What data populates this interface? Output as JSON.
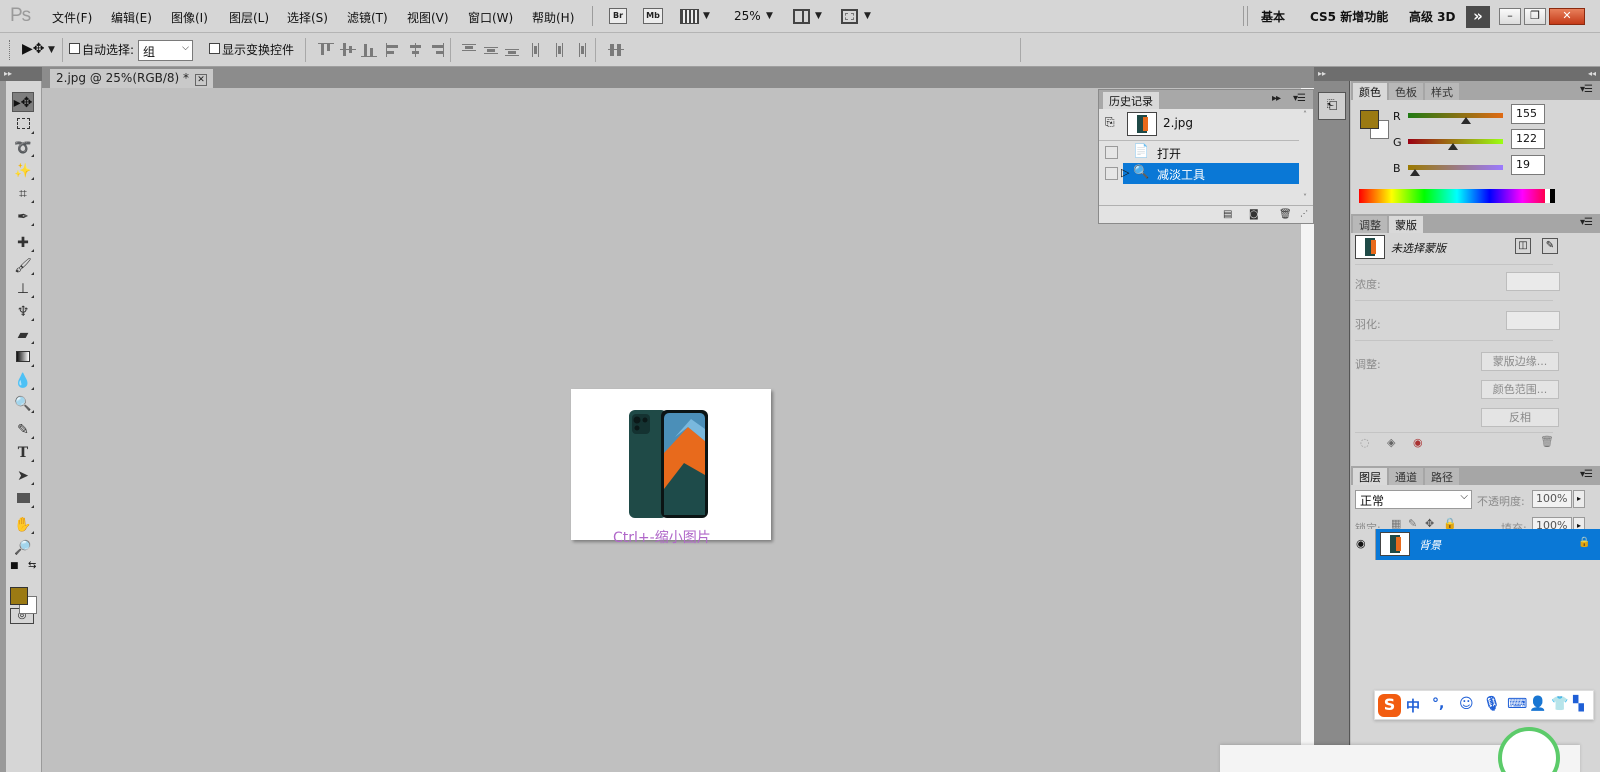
{
  "menubar": {
    "logo": "Ps",
    "items": [
      "文件(F)",
      "编辑(E)",
      "图像(I)",
      "图层(L)",
      "选择(S)",
      "滤镜(T)",
      "视图(V)",
      "窗口(W)",
      "帮助(H)"
    ],
    "bridge_label": "Br",
    "minibridge_label": "Mb",
    "zoom": "25%",
    "workspaces": [
      "基本",
      "CS5 新增功能",
      "高级 3D"
    ],
    "expand_label": "»"
  },
  "options": {
    "auto_select_label": "自动选择:",
    "auto_select_value": "组",
    "show_transform_label": "显示变换控件"
  },
  "document": {
    "tab_title": "2.jpg @ 25%(RGB/8) *",
    "caption": "Ctrl+-缩小图片"
  },
  "history": {
    "tab": "历史记录",
    "snapshot": "2.jpg",
    "items": [
      {
        "label": "打开",
        "selected": false
      },
      {
        "label": "减淡工具",
        "selected": true
      }
    ]
  },
  "color": {
    "tabs": [
      "颜色",
      "色板",
      "样式"
    ],
    "fg": "#9b7a13",
    "bg": "#ffffff",
    "channels": [
      {
        "name": "R",
        "value": "155",
        "fraction": 0.608
      },
      {
        "name": "G",
        "value": "122",
        "fraction": 0.478
      },
      {
        "name": "B",
        "value": "19",
        "fraction": 0.075
      }
    ]
  },
  "masks": {
    "tabs": [
      "调整",
      "蒙版"
    ],
    "title": "未选择蒙版",
    "density_label": "浓度:",
    "feather_label": "羽化:",
    "refine_label": "调整:",
    "buttons": [
      "蒙版边缘...",
      "颜色范围...",
      "反相"
    ]
  },
  "layers": {
    "tabs": [
      "图层",
      "通道",
      "路径"
    ],
    "blend_mode": "正常",
    "opacity_label": "不透明度:",
    "opacity": "100%",
    "lock_label": "锁定:",
    "fill_label": "填充:",
    "fill": "100%",
    "layer_name": "背景"
  },
  "ime": {
    "logo": "S",
    "mode": "中",
    "punct": "°,"
  },
  "colors": {
    "selection_blue": "#0a78d6",
    "foreground": "#9b7a13",
    "accent_orange": "#f25c10"
  }
}
